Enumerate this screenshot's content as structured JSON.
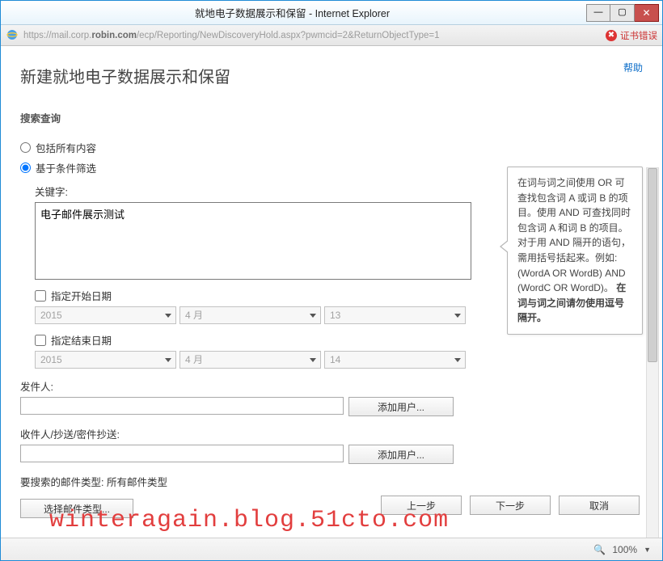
{
  "window": {
    "title": "就地电子数据展示和保留 - Internet Explorer",
    "minimize_glyph": "—",
    "maximize_glyph": "▢",
    "close_glyph": "✕"
  },
  "addressbar": {
    "url_pre": "https://mail.corp.",
    "url_bold": "robin.com",
    "url_post": "/ecp/Reporting/NewDiscoveryHold.aspx?pwmcid=2&ReturnObjectType=1",
    "cert_error_label": "证书错误",
    "cert_icon_glyph": "✖"
  },
  "help_link": "帮助",
  "page_title": "新建就地电子数据展示和保留",
  "section_search_query": "搜索查询",
  "radio_all": "包括所有内容",
  "radio_filter": "基于条件筛选",
  "keywords_label": "关键字:",
  "keywords_value": "电子邮件展示测试",
  "chk_start": "指定开始日期",
  "chk_end": "指定结束日期",
  "date_start": {
    "year": "2015",
    "month": "4 月",
    "day": "13"
  },
  "date_end": {
    "year": "2015",
    "month": "4 月",
    "day": "14"
  },
  "sender_label": "发件人:",
  "recipients_label": "收件人/抄送/密件抄送:",
  "add_user_label": "添加用户...",
  "msg_types_label": "要搜索的邮件类型: 所有邮件类型",
  "choose_types_label": "选择邮件类型...",
  "tip_main": "在词与词之间使用 OR 可查找包含词 A 或词 B 的项目。使用 AND 可查找同时包含词 A 和词 B 的项目。对于用 AND 隔开的语句，需用括号括起来。例如: (WordA OR WordB) AND (WordC OR WordD)。",
  "tip_bold": "在词与词之间请勿使用逗号隔开。",
  "footer": {
    "back": "上一步",
    "next": "下一步",
    "cancel": "取消"
  },
  "statusbar": {
    "zoom_icon": "🔍",
    "zoom": "100%",
    "arrow": "▼"
  },
  "watermark": "winteragain.blog.51cto.com"
}
